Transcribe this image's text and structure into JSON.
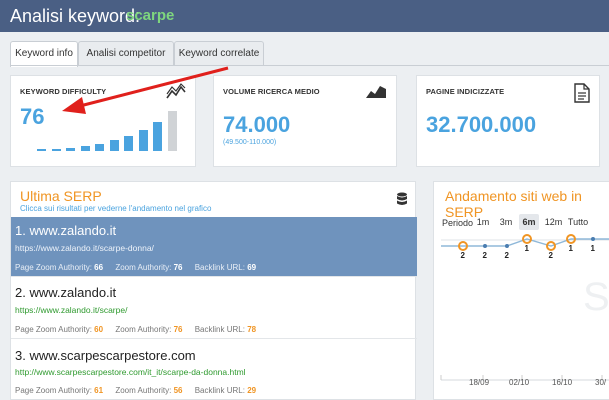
{
  "header": {
    "title": "Analisi keyword:",
    "keyword": "scarpe"
  },
  "tabs": [
    {
      "label": "Keyword info",
      "active": true
    },
    {
      "label": "Analisi competitor",
      "active": false
    },
    {
      "label": "Keyword correlate",
      "active": false
    }
  ],
  "cards": {
    "difficulty": {
      "title": "KEYWORD DIFFICULTY",
      "value": "76",
      "bar_levels": [
        1,
        2,
        3,
        5,
        7,
        10,
        14,
        20,
        28,
        38
      ]
    },
    "volume": {
      "title": "VOLUME RICERCA MEDIO",
      "value": "74.000",
      "range": "(49.500-110.000)"
    },
    "pages": {
      "title": "PAGINE INDICIZZATE",
      "value": "32.700.000"
    }
  },
  "serp": {
    "title": "Ultima SERP",
    "subtitle": "Clicca sui risultati per vederne l'andamento nel grafico",
    "metric_labels": {
      "pza": "Page Zoom Authority:",
      "za": "Zoom Authority:",
      "bl": "Backlink URL:"
    },
    "items": [
      {
        "rank": "1. www.zalando.it",
        "url": "https://www.zalando.it/scarpe-donna/",
        "pza": "66",
        "za": "76",
        "bl": "69",
        "selected": true
      },
      {
        "rank": "2. www.zalando.it",
        "url": "https://www.zalando.it/scarpe/",
        "pza": "60",
        "za": "76",
        "bl": "78",
        "selected": false
      },
      {
        "rank": "3. www.scarpescarpestore.com",
        "url": "http://www.scarpescarpestore.com/it_it/scarpe-da-donna.html",
        "pza": "61",
        "za": "56",
        "bl": "29",
        "selected": false
      }
    ]
  },
  "trend": {
    "title": "Andamento siti web in SERP",
    "period_label": "Periodo",
    "period_buttons": [
      {
        "label": "1m",
        "active": false
      },
      {
        "label": "3m",
        "active": false
      },
      {
        "label": "6m",
        "active": true
      },
      {
        "label": "12m",
        "active": false
      },
      {
        "label": "Tutto",
        "active": false
      }
    ],
    "point_labels": [
      "2",
      "2",
      "2",
      "1",
      "2",
      "1",
      "1"
    ],
    "x_ticks": [
      "18/09",
      "02/10",
      "16/10",
      "30/"
    ]
  },
  "colors": {
    "accent": "#4aa3df",
    "orange": "#f09524",
    "header": "#4a5f84",
    "selected_row": "#6f93bd"
  }
}
